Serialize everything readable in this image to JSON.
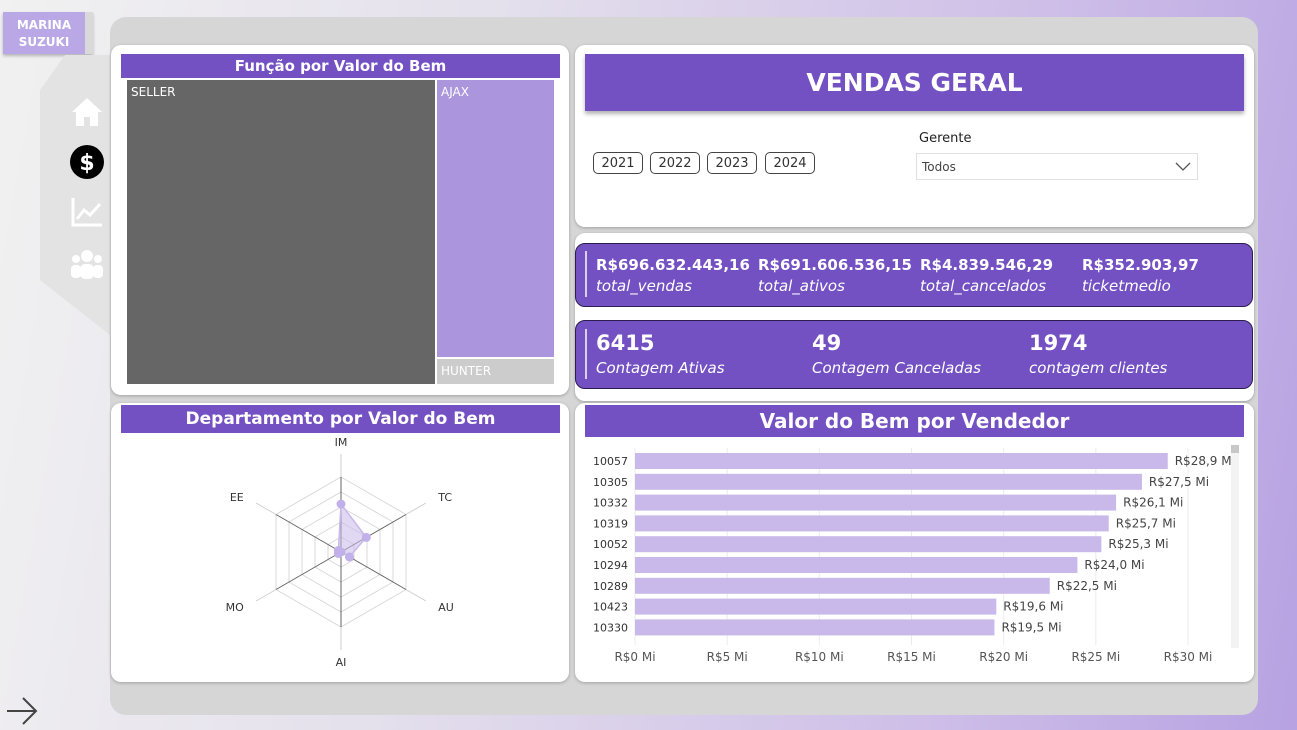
{
  "user_badge": {
    "line1": "MARINA",
    "line2": "SUZUKI"
  },
  "nav": {
    "items": [
      "home-icon",
      "dollar-icon",
      "chart-line-icon",
      "users-icon"
    ],
    "active": "dollar-icon"
  },
  "treemap_card": {
    "title": "Função por Valor do Bem",
    "cells": {
      "seller": "SELLER",
      "ajax": "AJAX",
      "hunter": "HUNTER"
    }
  },
  "header_card": {
    "title": "VENDAS GERAL",
    "years": [
      "2021",
      "2022",
      "2023",
      "2024"
    ],
    "gerente_label": "Gerente",
    "gerente_value": "Todos"
  },
  "kpis_money": [
    {
      "value": "R$696.632.443,16",
      "label": "total_vendas"
    },
    {
      "value": "R$691.606.536,15",
      "label": "total_ativos"
    },
    {
      "value": "R$4.839.546,29",
      "label": "total_cancelados"
    },
    {
      "value": "R$352.903,97",
      "label": "ticketmedio"
    }
  ],
  "kpis_counts": [
    {
      "value": "6415",
      "label": "Contagem Ativas"
    },
    {
      "value": "49",
      "label": "Contagem Canceladas"
    },
    {
      "value": "1974",
      "label": "contagem clientes"
    }
  ],
  "radar_card": {
    "title": "Departamento por Valor do Bem"
  },
  "bar_card": {
    "title": "Valor do Bem por Vendedor"
  },
  "colors": {
    "accent": "#7451c3",
    "bar": "#c8b9ea",
    "treemap_seller": "#666666",
    "treemap_ajax": "#ab95dd",
    "treemap_hunter": "#cccccc"
  },
  "chart_data": [
    {
      "type": "bar",
      "orientation": "horizontal",
      "title": "Valor do Bem por Vendedor",
      "categories": [
        "10057",
        "10305",
        "10332",
        "10319",
        "10052",
        "10294",
        "10289",
        "10423",
        "10330"
      ],
      "values": [
        28.9,
        27.5,
        26.1,
        25.7,
        25.3,
        24.0,
        22.5,
        19.6,
        19.5
      ],
      "value_labels": [
        "R$28,9 Mi",
        "R$27,5 Mi",
        "R$26,1 Mi",
        "R$25,7 Mi",
        "R$25,3 Mi",
        "R$24,0 Mi",
        "R$22,5 Mi",
        "R$19,6 Mi",
        "R$19,5 Mi"
      ],
      "xticks": [
        "R$0 Mi",
        "R$5 Mi",
        "R$10 Mi",
        "R$15 Mi",
        "R$20 Mi",
        "R$25 Mi",
        "R$30 Mi"
      ],
      "xlim": [
        0,
        30
      ],
      "grid": true
    },
    {
      "type": "radar",
      "title": "Departamento por Valor do Bem",
      "axes": [
        "IM",
        "TC",
        "AU",
        "AI",
        "MO",
        "EE"
      ],
      "values": [
        0.64,
        0.39,
        0.13,
        0.0,
        0.04,
        0.04
      ]
    },
    {
      "type": "treemap",
      "title": "Função por Valor do Bem",
      "categories": [
        "SELLER",
        "AJAX",
        "HUNTER"
      ],
      "shares": [
        0.7,
        0.26,
        0.04
      ]
    }
  ]
}
